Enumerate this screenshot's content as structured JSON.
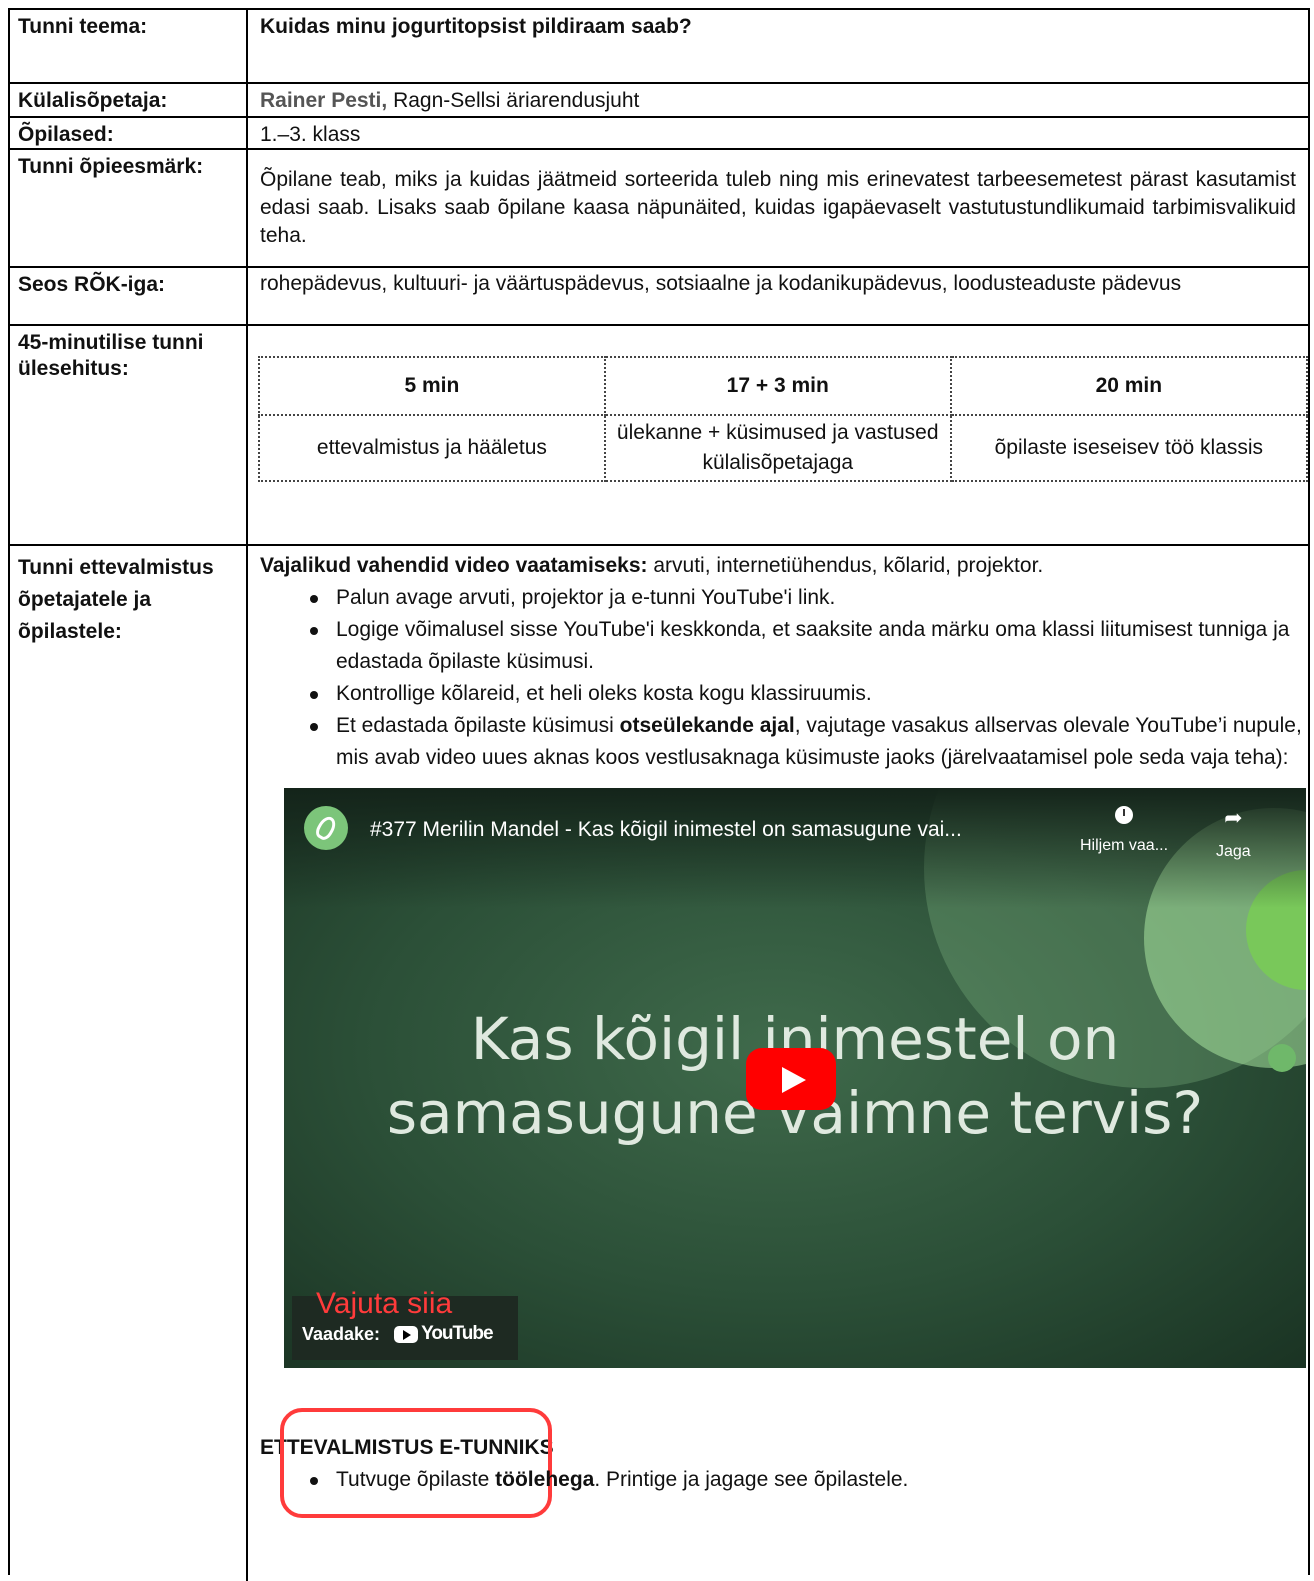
{
  "rows": {
    "topic": {
      "label": "Tunni teema:",
      "value": "Kuidas minu jogurtitopsist pildiraam saab?"
    },
    "guest": {
      "label": "Külalisõpetaja:",
      "name": "Rainer Pesti,",
      "role": " Ragn-Sellsi äriarendusjuht"
    },
    "students": {
      "label": "Õpilased:",
      "value": "1.–3. klass"
    },
    "goal": {
      "label": "Tunni õpieesmärk:",
      "value": "Õpilane teab, miks ja kuidas jäätmeid sorteerida tuleb ning mis erinevatest tarbeesemetest pärast kasutamist edasi saab. Lisaks saab õpilane kaasa näpunäited, kuidas igapäevaselt vastutustundlikumaid tarbimisvalikuid teha."
    },
    "curriculum": {
      "label": "Seos RÕK-iga:",
      "value": "rohepädevus, kultuuri- ja väärtuspädevus, sotsiaalne ja kodanikupädevus, loodusteaduste pädevus"
    },
    "structure": {
      "label": "45-minutilise tunni ülesehitus:",
      "columns": [
        {
          "time": "5 min",
          "desc": "ettevalmistus ja hääletus"
        },
        {
          "time": "17 + 3 min",
          "desc": "ülekanne + küsimused ja vastused külalisõpetajaga"
        },
        {
          "time": "20 min",
          "desc": "õpilaste iseseisev töö klassis"
        }
      ]
    },
    "prep": {
      "label": "Tunni ettevalmistus õpetajatele ja õpilastele:",
      "tools_bold": "Vajalikud vahendid video vaatamiseks:",
      "tools_text": " arvuti, internetiühendus, kõlarid, projektor.",
      "bullets": [
        "Palun avage arvuti, projektor ja e-tunni YouTube'i link.",
        "Logige võimalusel sisse YouTube'i keskkonda, et saaksite anda märku oma klassi liitumisest tunniga ja edastada õpilaste küsimusi.",
        "Kontrollige kõlareid, et heli oleks kosta kogu klassiruumis."
      ],
      "bullet4_a": "Et edastada õpilaste küsimusi ",
      "bullet4_bold": "otseülekande ajal",
      "bullet4_b": ", vajutage vasakus allservas olevale YouTube’i nupule, mis avab video uues aknas koos vestlusaknaga küsimuste jaoks (järelvaatamisel pole seda vaja teha):",
      "video": {
        "title": "#377 Merilin Mandel - Kas kõigil inimestel on samasugune vai...",
        "watch_later": "Hiljem vaa...",
        "share": "Jaga",
        "headline_1": "Kas kõigil inimestel on",
        "headline_2": "samasugune vaimne tervis?",
        "hint": "Vajuta siia",
        "watch_on": "Vaadake:",
        "yt_label": "YouTube"
      },
      "section_title": "ETTEVALMISTUS E-TUNNIKS",
      "last_a": "Tutvuge õpilaste ",
      "last_bold": "töölehega",
      "last_b": ". Printige ja jagage see õpilastele."
    }
  }
}
